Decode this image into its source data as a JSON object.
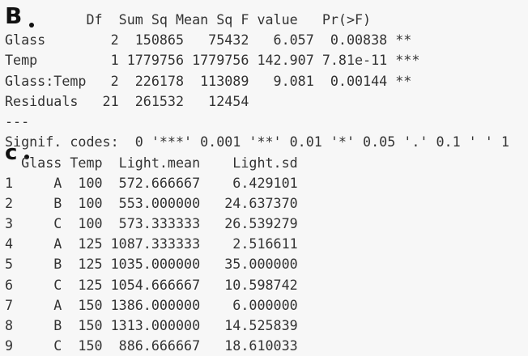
{
  "annotations": {
    "b_label": "B",
    "c_label": "c"
  },
  "anova": {
    "header": "          Df  Sum Sq Mean Sq F value   Pr(>F)    ",
    "rows": [
      "Glass        2  150865   75432   6.057  0.00838 ** ",
      "Temp         1 1779756 1779756 142.907 7.81e-11 ***",
      "Glass:Temp   2  226178  113089   9.081  0.00144 ** ",
      "Residuals   21  261532   12454                     "
    ],
    "separator": "---",
    "signif_codes": "Signif. codes:  0 '***' 0.001 '**' 0.01 '*' 0.05 '.' 0.1 ' ' 1"
  },
  "summary_table": {
    "header": "  Glass Temp  Light.mean    Light.sd",
    "rows": [
      "1     A  100  572.666667    6.429101",
      "2     B  100  553.000000   24.637370",
      "3     C  100  573.333333   26.539279",
      "4     A  125 1087.333333    2.516611",
      "5     B  125 1035.000000   35.000000",
      "6     C  125 1054.666667   10.598742",
      "7     A  150 1386.000000    6.000000",
      "8     B  150 1313.000000   14.525839",
      "9     C  150  886.666667   18.610033"
    ]
  }
}
